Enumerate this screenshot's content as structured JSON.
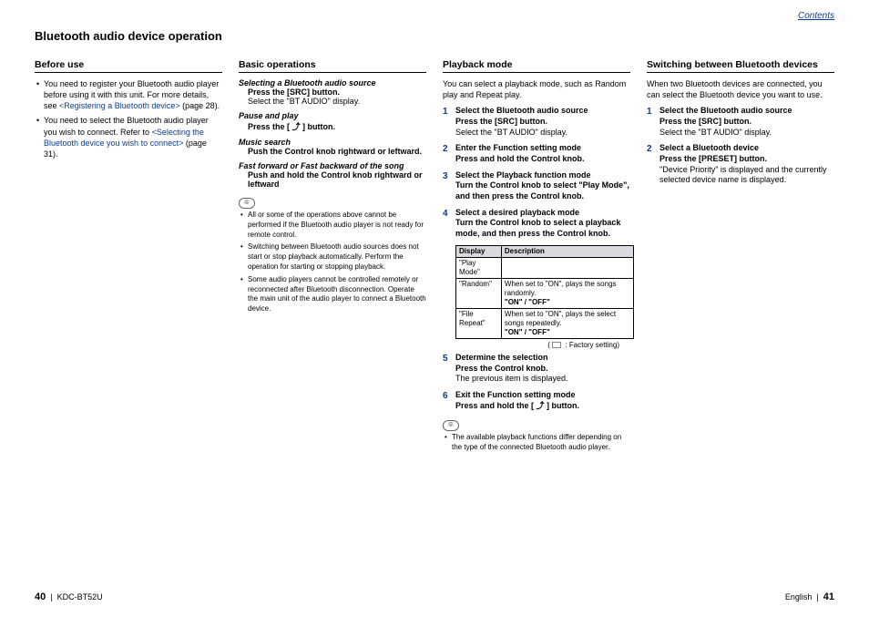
{
  "top_link": "Contents",
  "page_title": "Bluetooth audio device operation",
  "before": {
    "heading": "Before use",
    "items": [
      {
        "pre": "You need to register your Bluetooth audio player before using it with this unit. For more details, see ",
        "link": "<Registering a Bluetooth device>",
        "post": " (page 28)."
      },
      {
        "pre": "You need to select the Bluetooth audio player you wish to connect. Refer to ",
        "link": "<Selecting the Bluetooth device you wish to connect>",
        "post": " (page 31)."
      }
    ]
  },
  "basic": {
    "heading": "Basic operations",
    "ops": [
      {
        "title": "Selecting a Bluetooth audio source",
        "instr": "Press the [SRC] button.",
        "sub": "Select the \"BT AUDIO\" display."
      },
      {
        "title": "Pause and play",
        "instr": "Press the [ ⤴ ] button.",
        "sub": ""
      },
      {
        "title": "Music search",
        "instr": "Push the Control knob rightward or leftward.",
        "sub": ""
      },
      {
        "title": "Fast forward or Fast backward of the song",
        "instr": "Push and hold the Control knob rightward or leftward",
        "sub": ""
      }
    ],
    "note_icon": "⦾",
    "notes": [
      "All or some of the operations above cannot be performed if the Bluetooth audio player is not ready for remote control.",
      "Switching between Bluetooth audio sources does not start or stop playback automatically. Perform the operation for starting or stopping playback.",
      "Some audio players cannot be controlled remotely or reconnected after Bluetooth disconnection. Operate the main unit of the audio player to connect a Bluetooth device."
    ]
  },
  "playback": {
    "heading": "Playback mode",
    "intro": "You can select a playback mode, such as Random play and Repeat play.",
    "steps": [
      {
        "n": "1",
        "title": "Select the Bluetooth audio source",
        "instr": "Press the [SRC] button.",
        "sub": "Select the \"BT AUDIO\" display."
      },
      {
        "n": "2",
        "title": "Enter the Function setting mode",
        "instr": "Press and hold the Control knob.",
        "sub": ""
      },
      {
        "n": "3",
        "title": "Select the Playback function mode",
        "instr": "Turn the Control knob to select \"Play Mode\", and then press the Control knob.",
        "sub": ""
      },
      {
        "n": "4",
        "title": "Select a desired playback mode",
        "instr": "Turn the Control knob to select a playback mode, and then press the Control knob.",
        "sub": ""
      }
    ],
    "table": {
      "headers": [
        "Display",
        "Description"
      ],
      "rows": [
        [
          "\"Play Mode\"",
          ""
        ],
        [
          "   \"Random\"",
          "When set to \"ON\", plays the songs randomly.\n\"ON\" / \"OFF\""
        ],
        [
          "   \"File Repeat\"",
          "When set to \"ON\", plays the select songs repeatedly.\n\"ON\" / \"OFF\""
        ]
      ]
    },
    "table_caption": ": Factory setting)",
    "steps2": [
      {
        "n": "5",
        "title": "Determine the selection",
        "instr": "Press the Control knob.",
        "sub": "The previous item is displayed."
      },
      {
        "n": "6",
        "title": "Exit the Function setting mode",
        "instr": "Press and hold the [ ⤴ ] button.",
        "sub": ""
      }
    ],
    "note_icon": "⦾",
    "notes": [
      "The available playback functions differ depending on the type of the connected Bluetooth audio player."
    ]
  },
  "switching": {
    "heading": "Switching between Bluetooth devices",
    "intro": "When two Bluetooth devices are connected, you can select the Bluetooth device you want to use.",
    "steps": [
      {
        "n": "1",
        "title": "Select the Bluetooth audio source",
        "instr": "Press the [SRC] button.",
        "sub": "Select the \"BT AUDIO\" display."
      },
      {
        "n": "2",
        "title": "Select a Bluetooth device",
        "instr": "Press the [PRESET] button.",
        "sub": "\"Device Priority\" is displayed and the currently selected device name is displayed."
      }
    ]
  },
  "footer": {
    "left_page": "40",
    "left_model": "KDC-BT52U",
    "right_lang": "English",
    "right_page": "41"
  }
}
